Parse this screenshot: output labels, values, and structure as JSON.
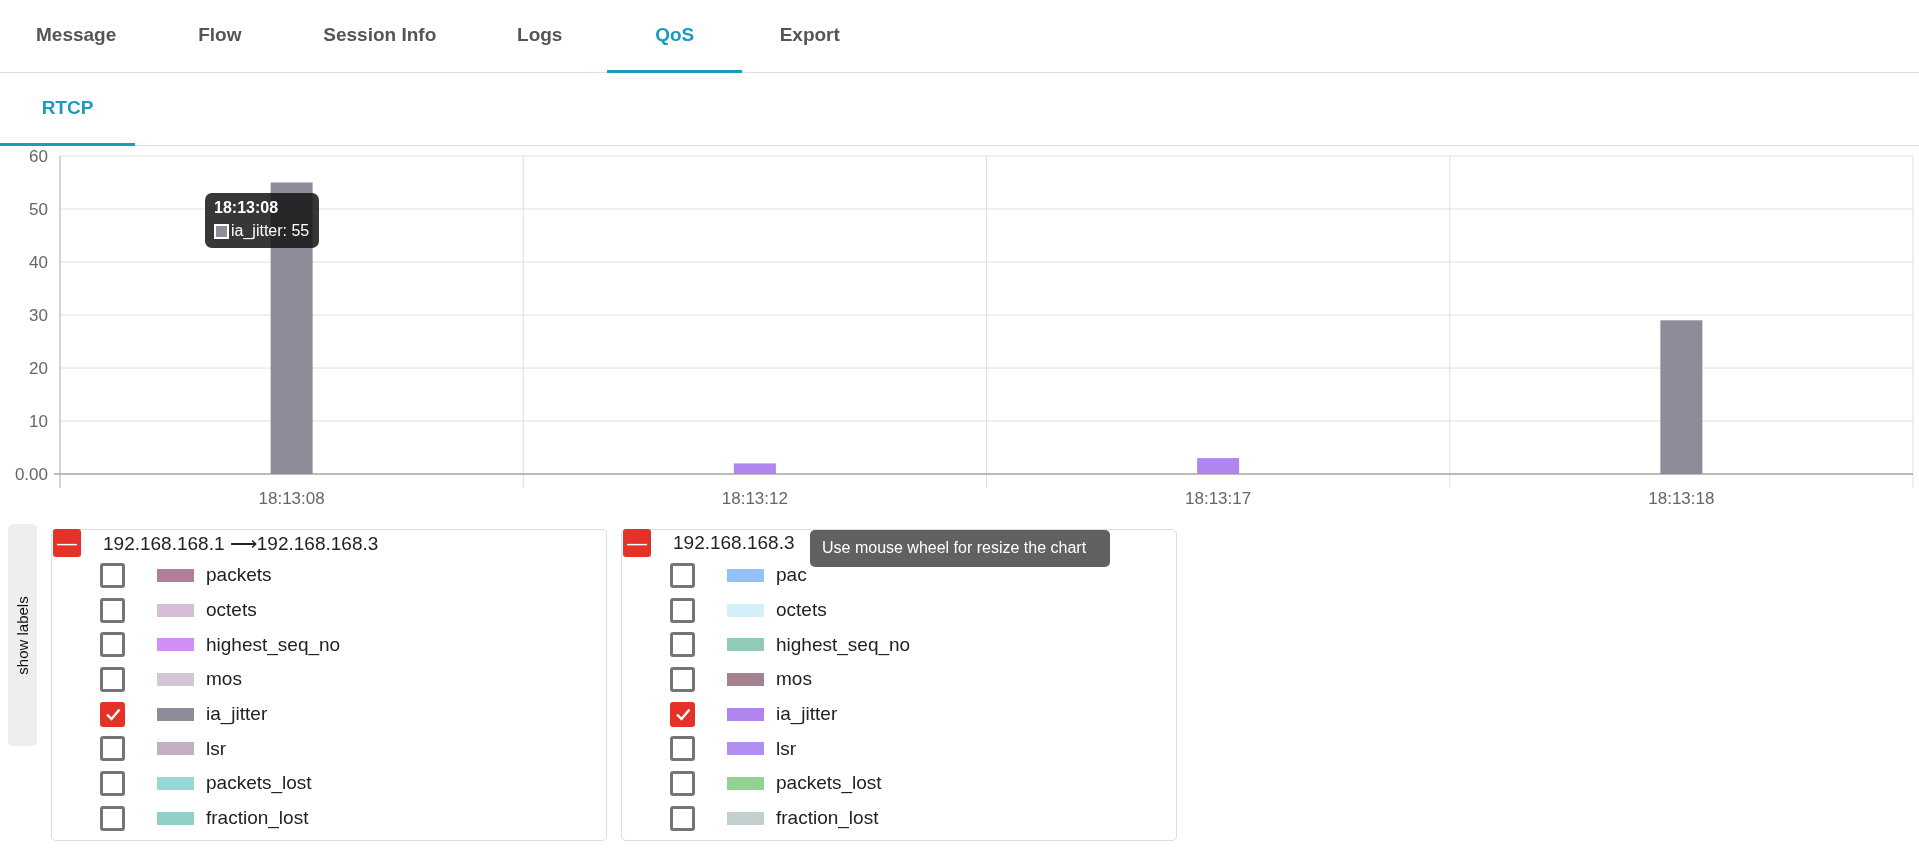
{
  "tabs": [
    {
      "label": "Message",
      "selected": false
    },
    {
      "label": "Flow",
      "selected": false
    },
    {
      "label": "Session Info",
      "selected": false
    },
    {
      "label": "Logs",
      "selected": false
    },
    {
      "label": "QoS",
      "selected": true
    },
    {
      "label": "Export",
      "selected": false
    }
  ],
  "subtabs": [
    {
      "label": "RTCP",
      "selected": true
    }
  ],
  "chart": {
    "chart_data": {
      "type": "bar",
      "grid": true,
      "categories": [
        "18:13:08",
        "18:13:12",
        "18:13:17",
        "18:13:18"
      ],
      "ylim": [
        0,
        60
      ],
      "yticks": [
        {
          "value": 0,
          "label": "0.00"
        },
        10,
        20,
        30,
        40,
        50,
        60
      ],
      "series": [
        {
          "color": "#8f8c99",
          "values": [
            55,
            null,
            null,
            29
          ]
        },
        {
          "color": "#b085ee",
          "values": [
            null,
            2,
            3,
            null
          ]
        }
      ]
    },
    "tooltip": {
      "title": "18:13:08",
      "text": "ia_jitter: 55",
      "color": "#8f8c99"
    }
  },
  "show_labels_button": "show labels",
  "legend_groups": [
    {
      "title": "192.168.168.1 ⟶192.168.168.3",
      "collapse_icon": "—",
      "items": [
        {
          "label": "packets",
          "color": "#b07f96",
          "checked": false
        },
        {
          "label": "octets",
          "color": "#d6bfd6",
          "checked": false
        },
        {
          "label": "highest_seq_no",
          "color": "#cf8ff5",
          "checked": false
        },
        {
          "label": "mos",
          "color": "#d5c5d7",
          "checked": false
        },
        {
          "label": "ia_jitter",
          "color": "#8f8c99",
          "checked": true
        },
        {
          "label": "lsr",
          "color": "#c2b0c2",
          "checked": false
        },
        {
          "label": "packets_lost",
          "color": "#96d8d6",
          "checked": false
        },
        {
          "label": "fraction_lost",
          "color": "#93cfca",
          "checked": false
        }
      ]
    },
    {
      "title": "192.168.168.3",
      "collapse_icon": "—",
      "items": [
        {
          "label": "pac",
          "color": "#94c1f7",
          "checked": false
        },
        {
          "label": "octets",
          "color": "#d3eff8",
          "checked": false
        },
        {
          "label": "highest_seq_no",
          "color": "#91cbb7",
          "checked": false
        },
        {
          "label": "mos",
          "color": "#a48290",
          "checked": false
        },
        {
          "label": "ia_jitter",
          "color": "#b085ee",
          "checked": true
        },
        {
          "label": "lsr",
          "color": "#b08ff0",
          "checked": false
        },
        {
          "label": "packets_lost",
          "color": "#93d291",
          "checked": false
        },
        {
          "label": "fraction_lost",
          "color": "#c4d0cf",
          "checked": false
        }
      ]
    }
  ],
  "hint_tooltip": "Use mouse wheel for resize the chart"
}
